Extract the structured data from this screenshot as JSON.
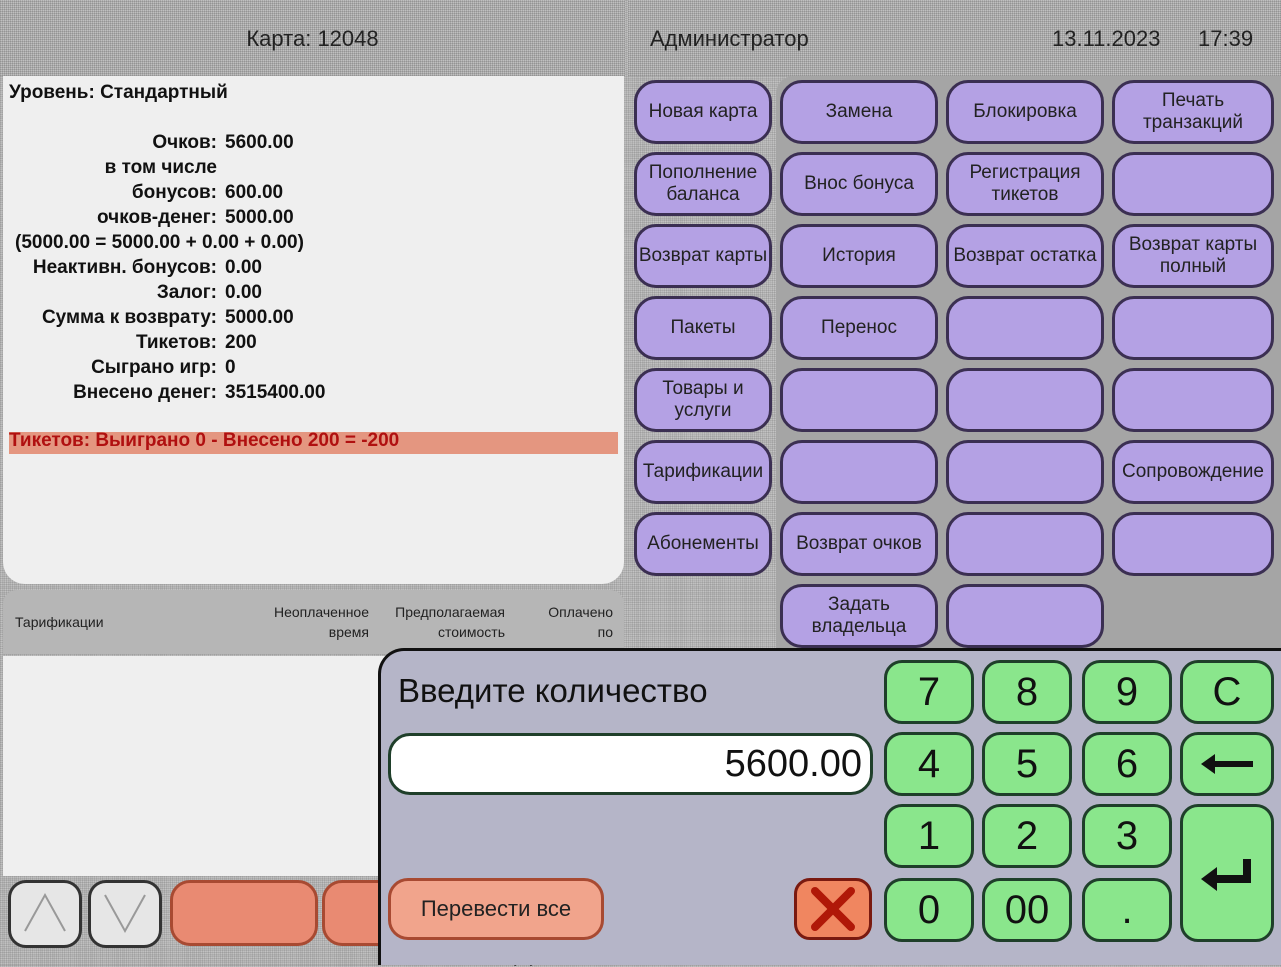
{
  "card": {
    "title": "Карта: 12048"
  },
  "info": {
    "level": "Уровень: Стандартный",
    "rows": [
      {
        "label": "Очков:",
        "value": "5600.00"
      },
      {
        "label": "в том числе",
        "value": ""
      },
      {
        "label": "бонусов:",
        "value": "600.00"
      },
      {
        "label": "очков-денег:",
        "value": "5000.00"
      },
      {
        "label": "(5000.00 = 5000.00 + 0.00 + 0.00)",
        "value": ""
      },
      {
        "label": "Неактивн. бонусов:",
        "value": "0.00"
      },
      {
        "label": "Залог:",
        "value": "0.00"
      },
      {
        "label": "Сумма к возврату:",
        "value": "5000.00"
      },
      {
        "label": "Тикетов:",
        "value": "200"
      },
      {
        "label": "Сыграно игр:",
        "value": "0"
      },
      {
        "label": "Внесено денег:",
        "value": "3515400.00"
      }
    ],
    "tickets_summary": "Тикетов: Выиграно 0 - Внесено 200 = -200"
  },
  "tarif_table": {
    "col1": "Тарификации",
    "col2": [
      "Неоплаченное",
      "время"
    ],
    "col3": [
      "Предполагаемая",
      "стоимость"
    ],
    "col4": [
      "Оплачено",
      "по"
    ]
  },
  "header": {
    "user": "Администратор",
    "date": "13.11.2023",
    "time": "17:39"
  },
  "actions": [
    {
      "label": "Новая карта",
      "enabled": true
    },
    {
      "label": "Замена",
      "enabled": true
    },
    {
      "label": "Блокировка",
      "enabled": true
    },
    {
      "label": "Печать транзакций",
      "enabled": true
    },
    {
      "label": "Пополнение баланса",
      "enabled": true
    },
    {
      "label": "Внос бонуса",
      "enabled": true
    },
    {
      "label": "Регистрация тикетов",
      "enabled": true
    },
    {
      "label": "Возврат карты",
      "enabled": true
    },
    {
      "label": "История",
      "enabled": true
    },
    {
      "label": "Возврат остатка",
      "enabled": true
    },
    {
      "label": "Возврат карты полный",
      "enabled": true
    },
    {
      "label": "Пакеты",
      "enabled": true
    },
    {
      "label": "Перенос",
      "enabled": true
    },
    {
      "label": "Товары и услуги",
      "enabled": true
    },
    {
      "label": "Тарификации",
      "enabled": true
    },
    {
      "label": "Сопровождение",
      "enabled": true
    },
    {
      "label": "Абонементы",
      "enabled": true
    },
    {
      "label": "Возврат очков",
      "enabled": true
    },
    {
      "label": "Задать владельца",
      "enabled": true
    }
  ],
  "dialog": {
    "title": "Введите количество",
    "value": "5600.00",
    "transfer_all": "Перевести все",
    "keys": [
      "7",
      "8",
      "9",
      "C",
      "4",
      "5",
      "6",
      "1",
      "2",
      "3",
      "0",
      "00",
      "."
    ]
  },
  "bottom_peek": [
    "услуги"
  ]
}
